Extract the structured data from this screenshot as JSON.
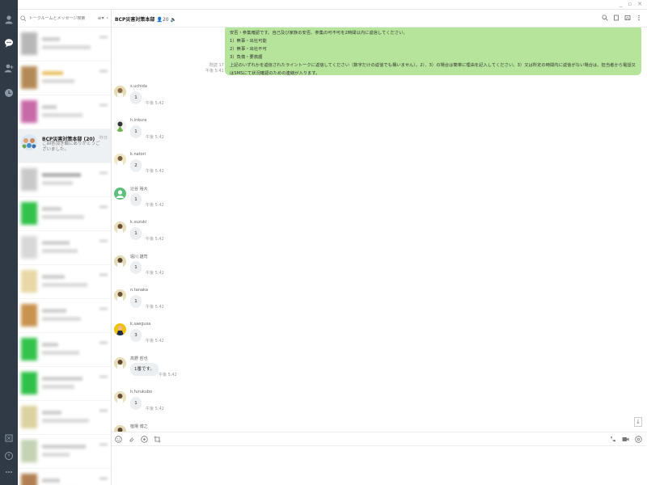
{
  "window": {
    "minimize": "_",
    "maximize": "▫",
    "close": "✕"
  },
  "rail": {
    "items": [
      {
        "icon": "friends-icon"
      },
      {
        "icon": "chats-icon",
        "active": true
      },
      {
        "icon": "add-friend-icon"
      },
      {
        "icon": "timeline-icon"
      }
    ],
    "bottom": [
      {
        "icon": "keep-icon"
      },
      {
        "icon": "notification-icon"
      },
      {
        "icon": "more-icon"
      }
    ]
  },
  "list": {
    "search_placeholder": "トークルームとメッセージ検索",
    "sort_label": "≡▾",
    "collapse_label": "‹",
    "active_chat": {
      "name": "BCP災害対策本部 (20)",
      "preview": "ご回答頂き誠にありがとうございました。",
      "time": "昨日"
    }
  },
  "header": {
    "title": "BCP災害対策本部",
    "members": "20",
    "mute_icon": "speaker-icon"
  },
  "messages": {
    "own": {
      "lines": [
        "安否・参集確認です。自己及び家族の安否、参集の可不可を2時間以内に返信してください。",
        "1）無事・出社可能",
        "2）無事・出社不可",
        "3）負傷・要救護",
        "上記のいずれかを返信されたライントークに返信してください（数字だけの返信でも構いません）。2）、3）の場合は簡単に理由を記入してください。3）又は所定の時間内に返信がない場合は、担当者から電話又はSMSにて状況確認のための連絡が入ります。"
      ],
      "read": "既読 17",
      "time": "午後 5:41"
    },
    "items": [
      {
        "name": "s.uchida",
        "text": "1",
        "time": "午後 5:42"
      },
      {
        "name": "h.inkura",
        "text": "1",
        "time": "午後 5:42"
      },
      {
        "name": "k.natori",
        "text": "2",
        "time": "午後 5:42"
      },
      {
        "name": "辻谷 裕大",
        "text": "1",
        "time": "午後 5:42"
      },
      {
        "name": "k.suzuki",
        "text": "1",
        "time": "午後 5:42"
      },
      {
        "name": "堀川 雄司",
        "text": "1",
        "time": "午後 5:42"
      },
      {
        "name": "n.tanaka",
        "text": "1",
        "time": "午後 5:42"
      },
      {
        "name": "k.saegusa",
        "text": "3",
        "time": "午後 5:42"
      },
      {
        "name": "高野 哲也",
        "text": "1番です。",
        "time": "午後 5:42"
      },
      {
        "name": "h.furukubo",
        "text": "1",
        "time": "午後 5:42"
      },
      {
        "name": "植場 博之",
        "text": "",
        "time": ""
      }
    ]
  },
  "composer": {
    "placeholder": ""
  }
}
